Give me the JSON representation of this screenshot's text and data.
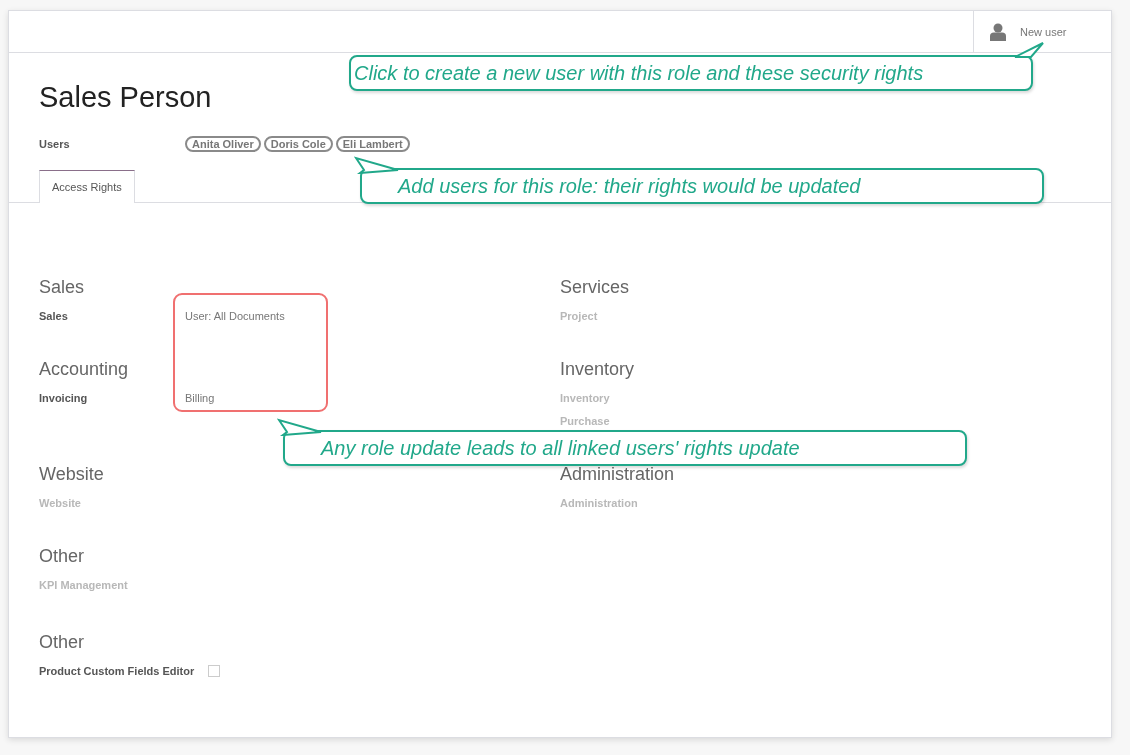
{
  "header": {
    "new_user_button": "New user"
  },
  "title": "Sales Person",
  "users": {
    "label": "Users",
    "tags": [
      "Anita Oliver",
      "Doris Cole",
      "Eli Lambert"
    ]
  },
  "tabs": [
    {
      "label": "Access Rights",
      "selected": true
    }
  ],
  "groups": [
    {
      "title": "Sales",
      "fields": [
        {
          "label": "Sales",
          "value": "User: All Documents",
          "disabled": false
        }
      ]
    },
    {
      "title": "Services",
      "fields": [
        {
          "label": "Project",
          "disabled": true
        }
      ]
    },
    {
      "title": "Accounting",
      "fields": [
        {
          "label": "Invoicing",
          "value": "Billing",
          "disabled": false
        }
      ]
    },
    {
      "title": "Inventory",
      "fields": [
        {
          "label": "Inventory",
          "disabled": true
        },
        {
          "label": "Purchase",
          "disabled": true
        }
      ]
    },
    {
      "title": "Website",
      "fields": [
        {
          "label": "Website",
          "disabled": true
        }
      ]
    },
    {
      "title": "Administration",
      "fields": [
        {
          "label": "Administration",
          "disabled": true
        }
      ]
    },
    {
      "title": "Other",
      "fields": [
        {
          "label": "KPI Management",
          "disabled": true
        }
      ]
    }
  ],
  "extra_group": {
    "title": "Other",
    "fields": [
      {
        "label": "Product Custom Fields Editor",
        "kind": "checkbox",
        "checked": false,
        "disabled": false
      }
    ]
  },
  "callouts": [
    {
      "text": "Click to create a new user with this role and these security rights"
    },
    {
      "text": "Add users for this role: their rights would be updated"
    },
    {
      "text": "Any role update leads to all linked users' rights update"
    }
  ]
}
